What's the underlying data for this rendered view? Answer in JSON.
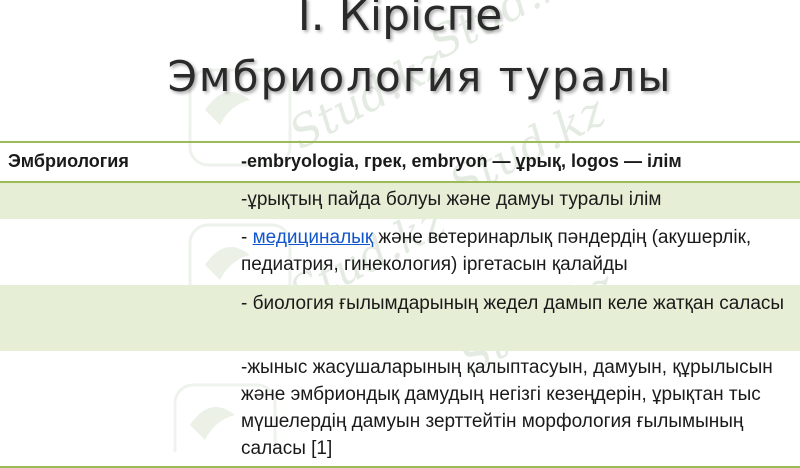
{
  "slide": {
    "title_line1": "I. Кіріспе",
    "title_line2": "Эмбриология  туралы"
  },
  "table": {
    "header": {
      "term": "Эмбриология",
      "definition": "-embryologia, грек, embryon — ұрық, logos — ілім"
    },
    "rows": [
      {
        "term": "",
        "definition": "-ұрықтың пайда болуы және дамуы туралы ілім"
      },
      {
        "term": "",
        "prefix": "- ",
        "link_text": "медициналық",
        "definition": " және ветеринарлық пәндердің (акушерлік, педиатрия, гинекология) іргетасын қалайды"
      },
      {
        "term": "",
        "definition": "- биология ғылымдарының жедел дамып келе жатқан саласы"
      },
      {
        "term": "",
        "definition": "-жыныс жасушаларының қалыптасуын, дамуын, құрылысын және эмбриондық дамудың негізгі кезеңдерін, ұрықтан тыс мүшелердің дамуын зерттейтін морфология ғылымының саласы [1]"
      }
    ]
  },
  "colors": {
    "accent_border": "#9bbb59",
    "shaded_row": "#e6eed5",
    "link": "#1155cc"
  }
}
